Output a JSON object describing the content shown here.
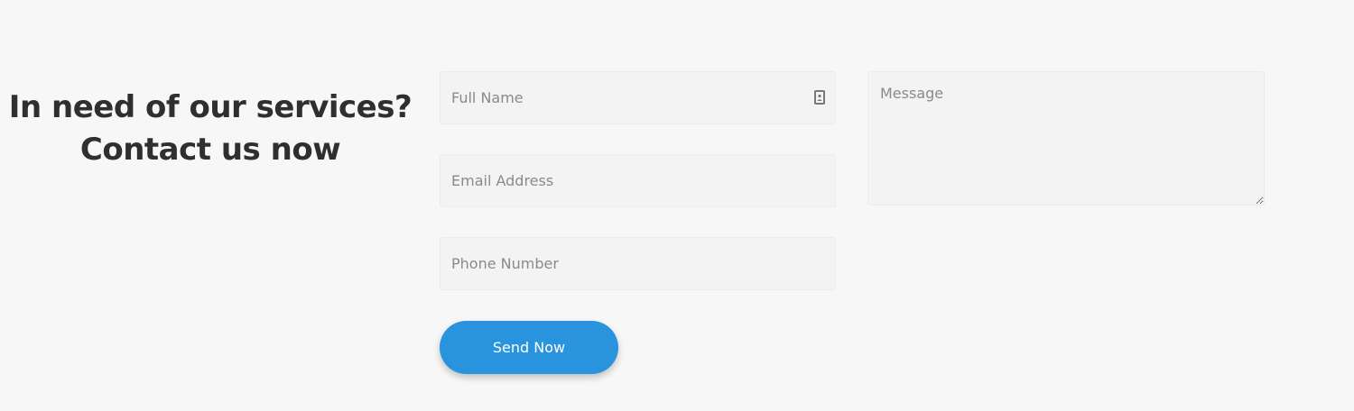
{
  "heading": {
    "line1": "In need of our services?",
    "line2": "Contact us now"
  },
  "form": {
    "full_name": {
      "value": "",
      "placeholder": "Full Name",
      "icon": "contact-card-icon"
    },
    "email": {
      "value": "",
      "placeholder": "Email Address"
    },
    "phone": {
      "value": "",
      "placeholder": "Phone Number"
    },
    "message": {
      "value": "",
      "placeholder": "Message"
    },
    "submit_label": "Send Now"
  },
  "colors": {
    "background": "#f7f7f7",
    "heading": "#2f2f2f",
    "field_background": "#f3f3f3",
    "button": "#2a93de",
    "button_text": "#ffffff"
  }
}
